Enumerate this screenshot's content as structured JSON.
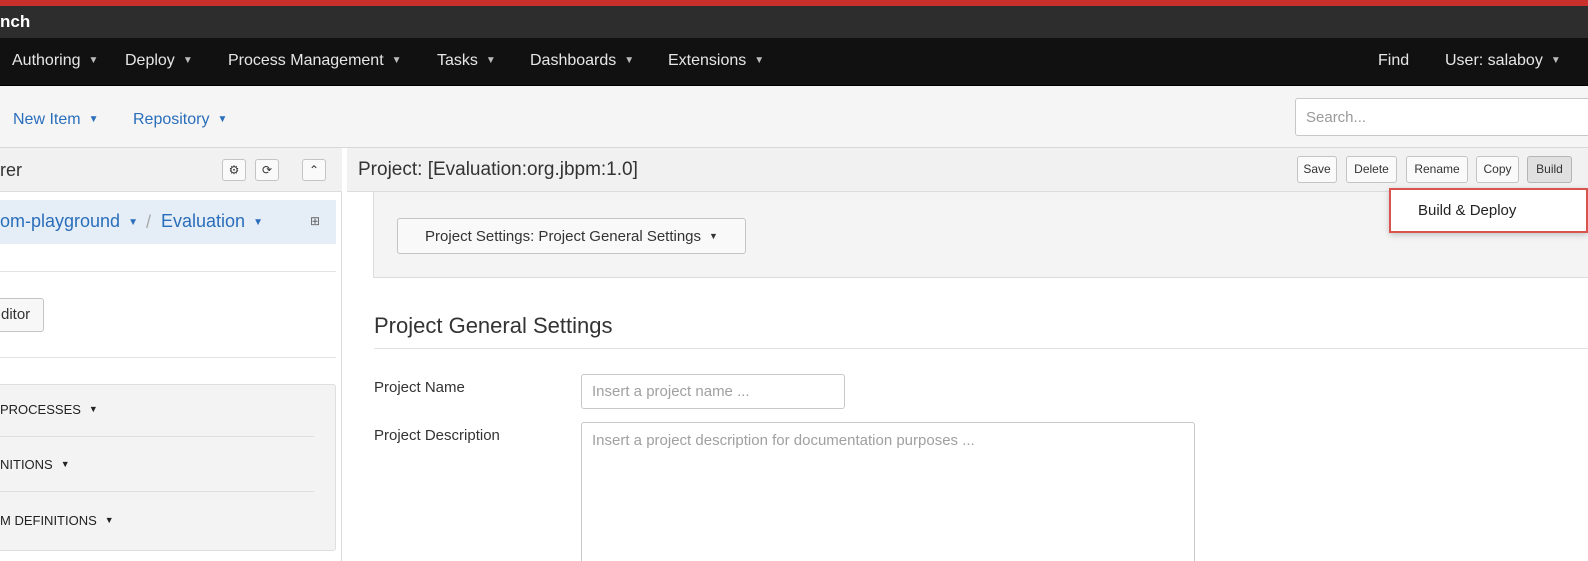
{
  "app": {
    "title": "nch"
  },
  "nav": {
    "items": [
      {
        "label": "Authoring"
      },
      {
        "label": "Deploy"
      },
      {
        "label": "Process Management"
      },
      {
        "label": "Tasks"
      },
      {
        "label": "Dashboards"
      },
      {
        "label": "Extensions"
      }
    ],
    "find": "Find",
    "user": "User: salaboy"
  },
  "toolbar": {
    "new_item": "New Item",
    "repository": "Repository",
    "search_placeholder": "Search..."
  },
  "explorer": {
    "title": "rer",
    "breadcrumb": {
      "repo": "om-playground",
      "separator": "/",
      "project": "Evaluation"
    },
    "editor_button": "ditor",
    "categories": [
      {
        "label": "PROCESSES"
      },
      {
        "label": "NITIONS"
      },
      {
        "label": "M DEFINITIONS"
      }
    ]
  },
  "project": {
    "title": "Project: [Evaluation:org.jbpm:1.0]",
    "actions": {
      "save": "Save",
      "delete": "Delete",
      "rename": "Rename",
      "copy": "Copy",
      "build": "Build"
    },
    "build_menu": {
      "item": "Build & Deploy"
    },
    "settings_selector": "Project Settings: Project General Settings",
    "section_title": "Project General Settings",
    "fields": {
      "name_label": "Project Name",
      "name_placeholder": "Insert a project name ...",
      "description_label": "Project Description",
      "description_placeholder": "Insert a project description for documentation purposes ..."
    }
  },
  "colors": {
    "accent_link": "#2a6ebb",
    "nav_background": "#111111",
    "highlight_border": "#d9534f"
  }
}
